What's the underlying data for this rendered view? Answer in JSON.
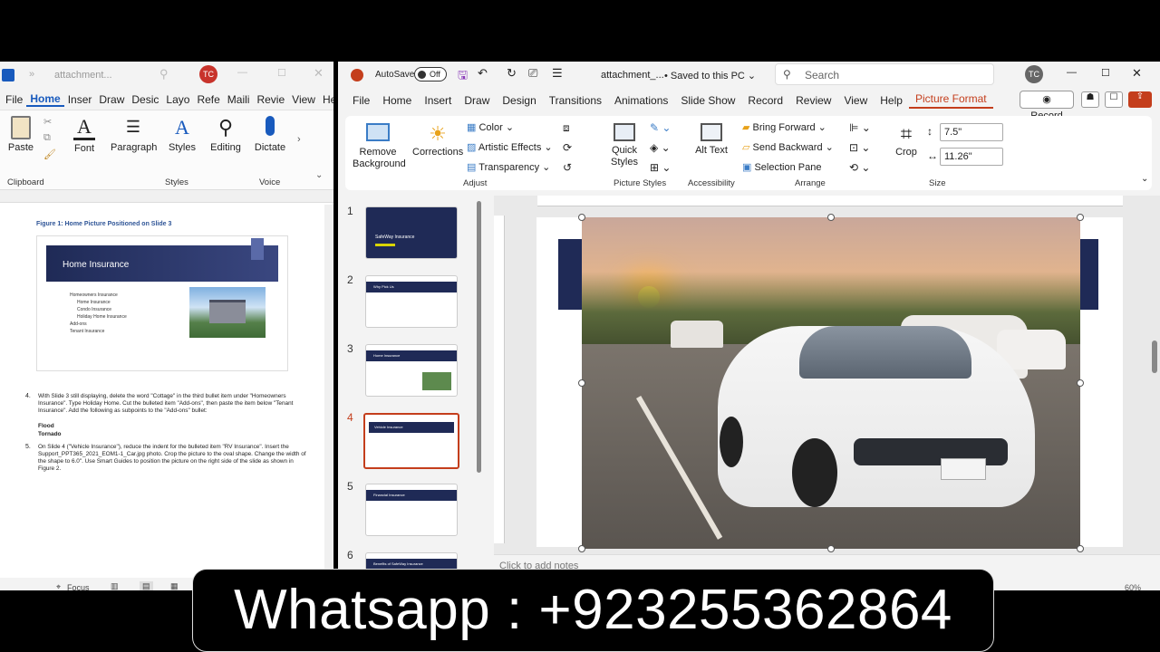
{
  "word": {
    "title": "attachment...",
    "avatar": "TC",
    "tabs": [
      "File",
      "Home",
      "Inser",
      "Draw",
      "Desic",
      "Layo",
      "Refe",
      "Maili",
      "Revie",
      "View",
      "Help"
    ],
    "ribbon": {
      "paste": "Paste",
      "font": "Font",
      "paragraph": "Paragraph",
      "styles": "Styles",
      "editing": "Editing",
      "dictate": "Dictate",
      "group_clipboard": "Clipboard",
      "group_styles": "Styles",
      "group_voice": "Voice"
    },
    "figure_caption": "Figure 1: Home Picture Positioned on Slide 3",
    "slide_title": "Home Insurance",
    "bullets": [
      "Homeowners Insurance",
      "Home Insurance",
      "Condo Insurance",
      "Holiday Home Insurance",
      "Add-ons",
      "Tenant Insurance"
    ],
    "step4_num": "4.",
    "step4": "With Slide 3 still displaying, delete the word \"Cottage\" in the third bullet item under \"Homeowners Insurance\". Type Holiday Home. Cut the bulleted item \"Add-ons\", then paste the item below \"Tenant Insurance\". Add the following as subpoints to the \"Add-ons\" bullet:",
    "step4_sub1": "Flood",
    "step4_sub2": "Tornado",
    "step5_num": "5.",
    "step5": "On Slide 4 (\"Vehicle Insurance\"), reduce the indent for the bulleted item \"RV Insurance\". Insert the Support_PPT365_2021_EOM1-1_Car.jpg photo. Crop the picture to the oval shape. Change the width of the shape to 6.0\". Use Smart Guides to position the picture on the right side of the slide as shown in Figure 2.",
    "status_focus": "Focus"
  },
  "ppt": {
    "autosave": "AutoSave",
    "autosave_state": "Off",
    "title": "attachment_...",
    "saved": "Saved to this PC",
    "search_placeholder": "Search",
    "avatar": "TC",
    "tabs": [
      "File",
      "Home",
      "Insert",
      "Draw",
      "Design",
      "Transitions",
      "Animations",
      "Slide Show",
      "Record",
      "Review",
      "View",
      "Help",
      "Picture Format"
    ],
    "record_button": "Record",
    "ribbon": {
      "remove_background": "Remove Background",
      "corrections": "Corrections",
      "color": "Color",
      "artistic_effects": "Artistic Effects",
      "transparency": "Transparency",
      "quick_styles": "Quick Styles",
      "alt_text": "Alt Text",
      "bring_forward": "Bring Forward",
      "send_backward": "Send Backward",
      "selection_pane": "Selection Pane",
      "crop": "Crop",
      "height": "7.5\"",
      "width": "11.26\"",
      "group_adjust": "Adjust",
      "group_picture_styles": "Picture Styles",
      "group_accessibility": "Accessibility",
      "group_arrange": "Arrange",
      "group_size": "Size"
    },
    "slide_numbers": [
      "1",
      "2",
      "3",
      "4",
      "5",
      "6"
    ],
    "thumb_titles": [
      "SafeWay Insurance",
      "Why Pick Us",
      "Home Insurance",
      "Vehicle Insurance",
      "Financial Insurance",
      "Benefits of SafeWay Insurance"
    ],
    "notes_placeholder": "Click to add notes",
    "zoom": "60%"
  },
  "overlay": {
    "contact": "Whatsapp : +923255362864"
  }
}
